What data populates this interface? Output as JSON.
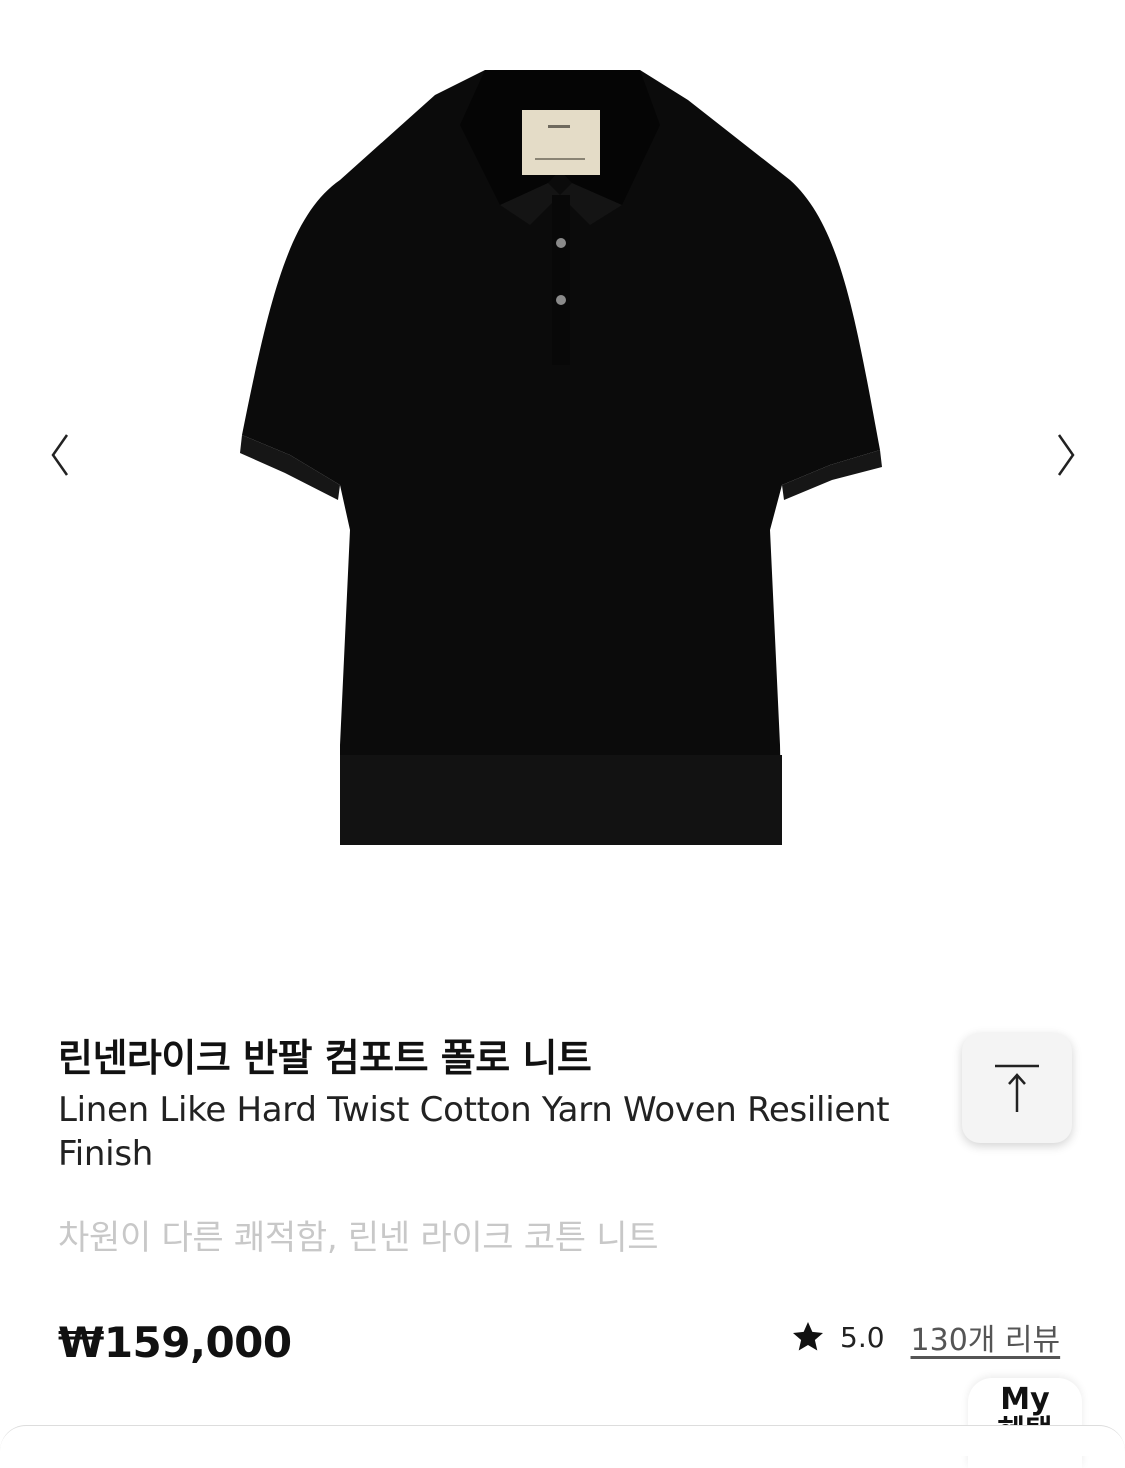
{
  "gallery": {
    "prev_icon": "chevron-left-icon",
    "next_icon": "chevron-right-icon",
    "image_alt": "black short sleeve polo knit"
  },
  "product": {
    "title_ko": "린넨라이크 반팔 컴포트 폴로 니트",
    "title_en": "Linen Like Hard Twist Cotton Yarn Woven Resilient Finish",
    "subtitle": "차원이 다른 쾌적함, 린넨 라이크 코튼 니트",
    "price": "₩159,000",
    "rating": "5.0",
    "review_link": "130개 리뷰"
  },
  "floating": {
    "scroll_top_icon": "arrow-up-to-top-icon",
    "my_benefit_line1": "My",
    "my_benefit_line2": "혜택"
  },
  "colors": {
    "accent": "#111111",
    "subtitle": "#c8c8c8",
    "garment": "#0b0b0b"
  }
}
